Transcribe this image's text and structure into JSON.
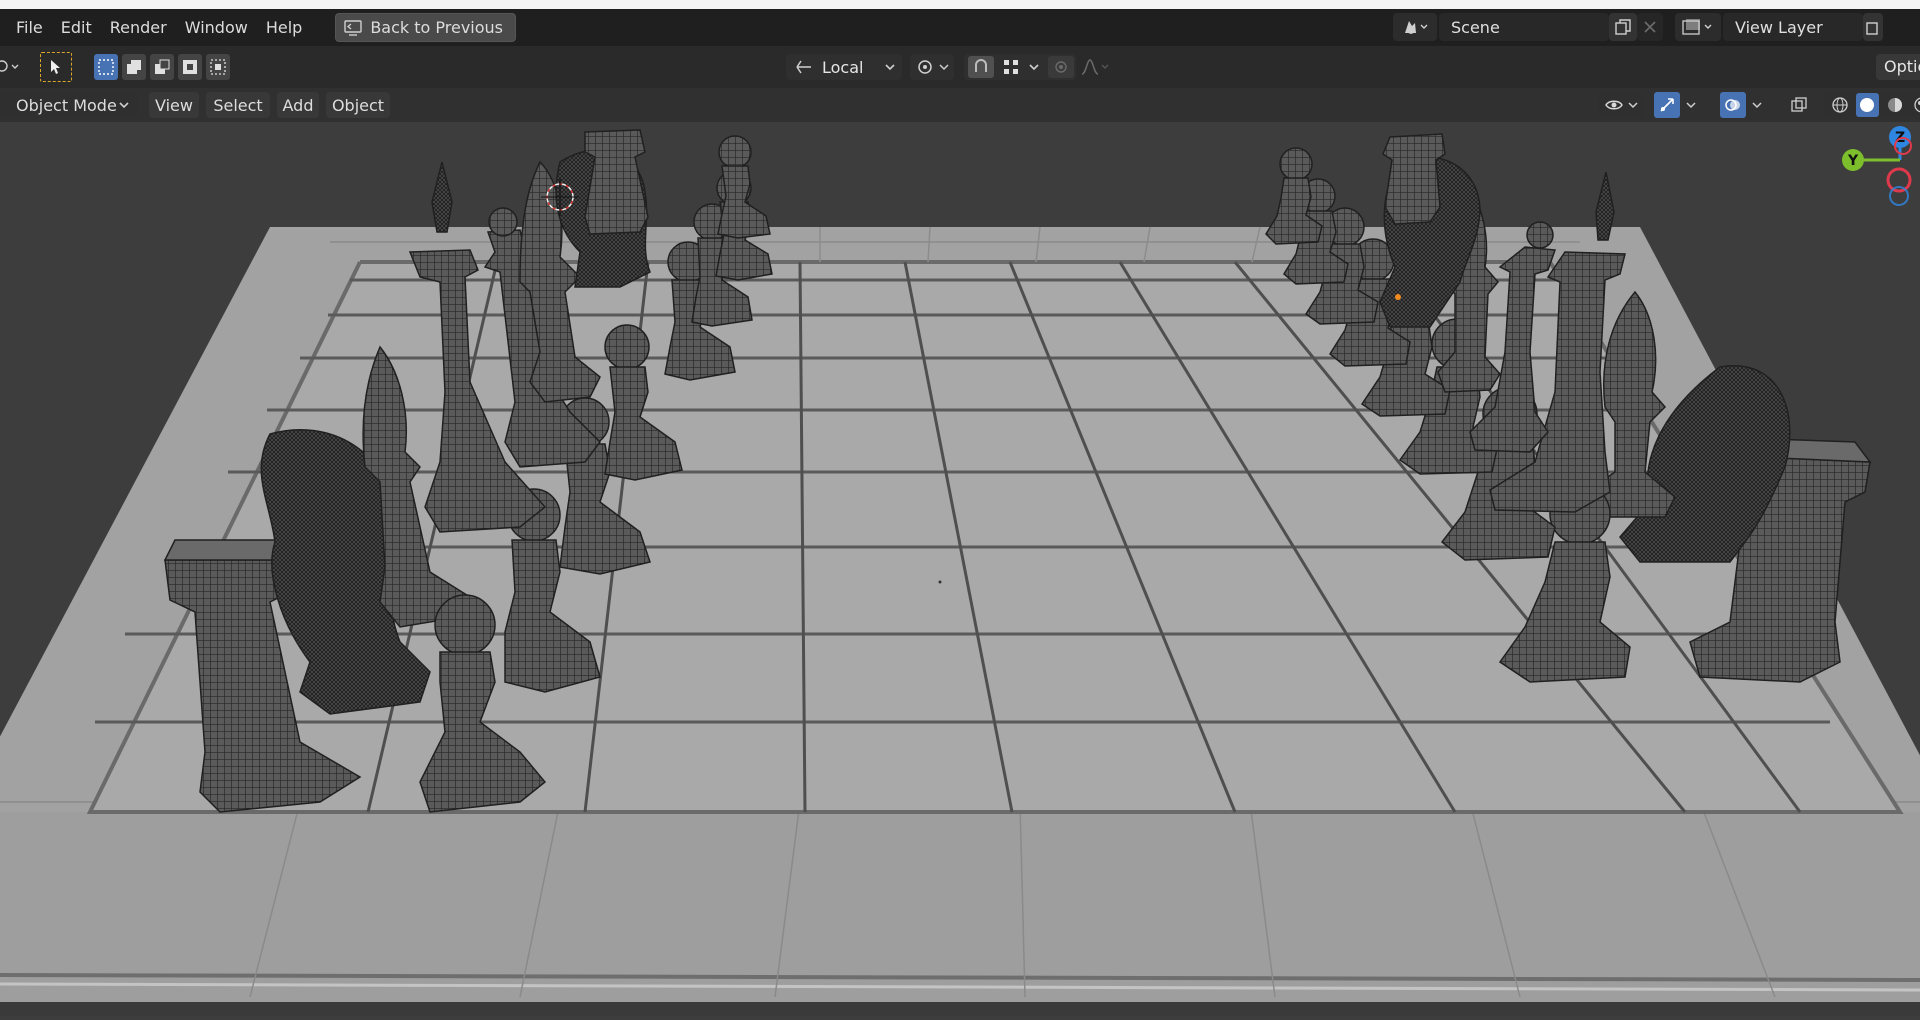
{
  "menu": {
    "file": "File",
    "edit": "Edit",
    "render": "Render",
    "window": "Window",
    "help": "Help",
    "back_to_previous": "Back to Previous"
  },
  "scene": {
    "name": "Scene",
    "view_layer": "View Layer"
  },
  "toolbar": {
    "transform_orientation": "Local",
    "options_label": "Optic"
  },
  "viewport_header": {
    "mode": "Object Mode",
    "view": "View",
    "select": "Select",
    "add": "Add",
    "object": "Object"
  },
  "gizmo": {
    "z": "Z",
    "y": "Y"
  },
  "colors": {
    "topbar": "#1f1f1f",
    "toolbar": "#2a2a2a",
    "header": "#303030",
    "viewport_bg": "#3d3d3d",
    "board": "#a4a4a4",
    "selected_blue": "#4772b3",
    "axis_x": "#e0394b",
    "axis_y": "#7cbe2c",
    "axis_z": "#2f86e0"
  }
}
